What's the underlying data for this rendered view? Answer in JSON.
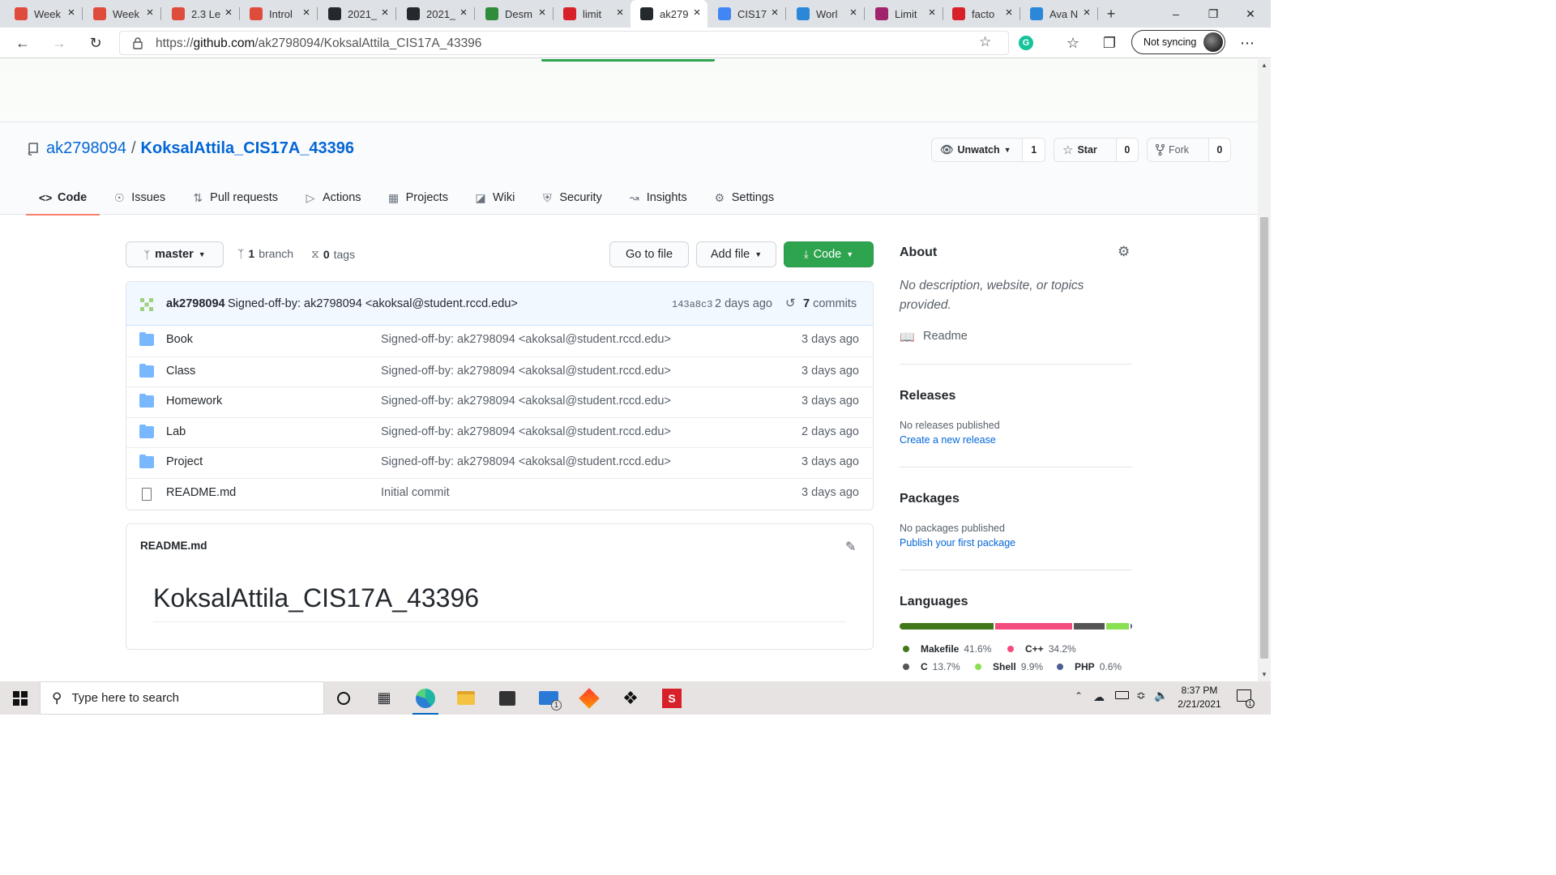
{
  "browser": {
    "tabs": [
      {
        "title": "Week",
        "favicon": "target-icon",
        "color": "#e04c3c"
      },
      {
        "title": "Week",
        "favicon": "target-icon",
        "color": "#e04c3c"
      },
      {
        "title": "2.3 Le",
        "favicon": "target-icon",
        "color": "#e04c3c"
      },
      {
        "title": "Introl",
        "favicon": "target-icon",
        "color": "#e04c3c"
      },
      {
        "title": "2021_",
        "favicon": "github-icon",
        "color": "#24292e"
      },
      {
        "title": "2021_",
        "favicon": "github-icon",
        "color": "#24292e"
      },
      {
        "title": "Desm",
        "favicon": "desmos-icon",
        "color": "#2f8c3a"
      },
      {
        "title": "limit",
        "favicon": "symbolab-icon",
        "color": "#d8202a"
      },
      {
        "title": "ak279",
        "favicon": "github-icon",
        "color": "#24292e",
        "active": true
      },
      {
        "title": "CIS17",
        "favicon": "docs-icon",
        "color": "#4285f4"
      },
      {
        "title": "Worl",
        "favicon": "bing-icon",
        "color": "#2b88d8"
      },
      {
        "title": "Limit",
        "favicon": "mathway-icon",
        "color": "#a0236b"
      },
      {
        "title": "facto",
        "favicon": "symbolab-icon",
        "color": "#d8202a"
      },
      {
        "title": "Ava N",
        "favicon": "bing-icon",
        "color": "#2b88d8"
      }
    ],
    "url_prefix": "https://",
    "url_host": "github.com",
    "url_path": "/ak2798094/KoksalAttila_CIS17A_43396",
    "sync_label": "Not syncing"
  },
  "repo": {
    "owner": "ak2798094",
    "separator": "/",
    "name": "KoksalAttila_CIS17A_43396",
    "watch_label": "Unwatch",
    "watch_count": "1",
    "star_label": "Star",
    "star_count": "0",
    "fork_label": "Fork",
    "fork_count": "0"
  },
  "nav": [
    {
      "label": "Code",
      "icon": "code-icon",
      "active": true
    },
    {
      "label": "Issues",
      "icon": "issue-icon"
    },
    {
      "label": "Pull requests",
      "icon": "pull-request-icon"
    },
    {
      "label": "Actions",
      "icon": "play-icon"
    },
    {
      "label": "Projects",
      "icon": "project-icon"
    },
    {
      "label": "Wiki",
      "icon": "book-icon"
    },
    {
      "label": "Security",
      "icon": "shield-icon"
    },
    {
      "label": "Insights",
      "icon": "graph-icon"
    },
    {
      "label": "Settings",
      "icon": "gear-icon"
    }
  ],
  "toolbar": {
    "branch": "master",
    "branch_count": "1",
    "branch_word": "branch",
    "tag_count": "0",
    "tag_word": "tags",
    "goto_label": "Go to file",
    "addfile_label": "Add file",
    "code_label": "Code"
  },
  "commit": {
    "author": "ak2798094",
    "message": "Signed-off-by: ak2798094 <akoksal@student.rccd.edu>",
    "sha": "143a8c3",
    "age": "2 days ago",
    "count": "7",
    "count_word": "commits"
  },
  "files": [
    {
      "name": "Book",
      "type": "folder",
      "message": "Signed-off-by: ak2798094 <akoksal@student.rccd.edu>",
      "age": "3 days ago"
    },
    {
      "name": "Class",
      "type": "folder",
      "message": "Signed-off-by: ak2798094 <akoksal@student.rccd.edu>",
      "age": "3 days ago"
    },
    {
      "name": "Homework",
      "type": "folder",
      "message": "Signed-off-by: ak2798094 <akoksal@student.rccd.edu>",
      "age": "3 days ago"
    },
    {
      "name": "Lab",
      "type": "folder",
      "message": "Signed-off-by: ak2798094 <akoksal@student.rccd.edu>",
      "age": "2 days ago"
    },
    {
      "name": "Project",
      "type": "folder",
      "message": "Signed-off-by: ak2798094 <akoksal@student.rccd.edu>",
      "age": "3 days ago"
    },
    {
      "name": "README.md",
      "type": "file",
      "message": "Initial commit",
      "age": "3 days ago"
    }
  ],
  "readme": {
    "filename": "README.md",
    "heading": "KoksalAttila_CIS17A_43396"
  },
  "sidebar": {
    "about_title": "About",
    "about_desc": "No description, website, or topics provided.",
    "readme_link": "Readme",
    "releases_title": "Releases",
    "releases_none": "No releases published",
    "releases_link": "Create a new release",
    "packages_title": "Packages",
    "packages_none": "No packages published",
    "packages_link": "Publish your first package",
    "languages_title": "Languages",
    "languages": [
      {
        "name": "Makefile",
        "percent": "41.6%",
        "value": 41.6,
        "color": "#427819"
      },
      {
        "name": "C++",
        "percent": "34.2%",
        "value": 34.2,
        "color": "#f34b7d"
      },
      {
        "name": "C",
        "percent": "13.7%",
        "value": 13.7,
        "color": "#555555"
      },
      {
        "name": "Shell",
        "percent": "9.9%",
        "value": 9.9,
        "color": "#89e051"
      },
      {
        "name": "PHP",
        "percent": "0.6%",
        "value": 0.6,
        "color": "#4f5d95"
      }
    ]
  },
  "taskbar": {
    "search_placeholder": "Type here to search",
    "time": "8:37 PM",
    "date": "2/21/2021",
    "mail_badge": "1",
    "notif_badge": "1"
  }
}
